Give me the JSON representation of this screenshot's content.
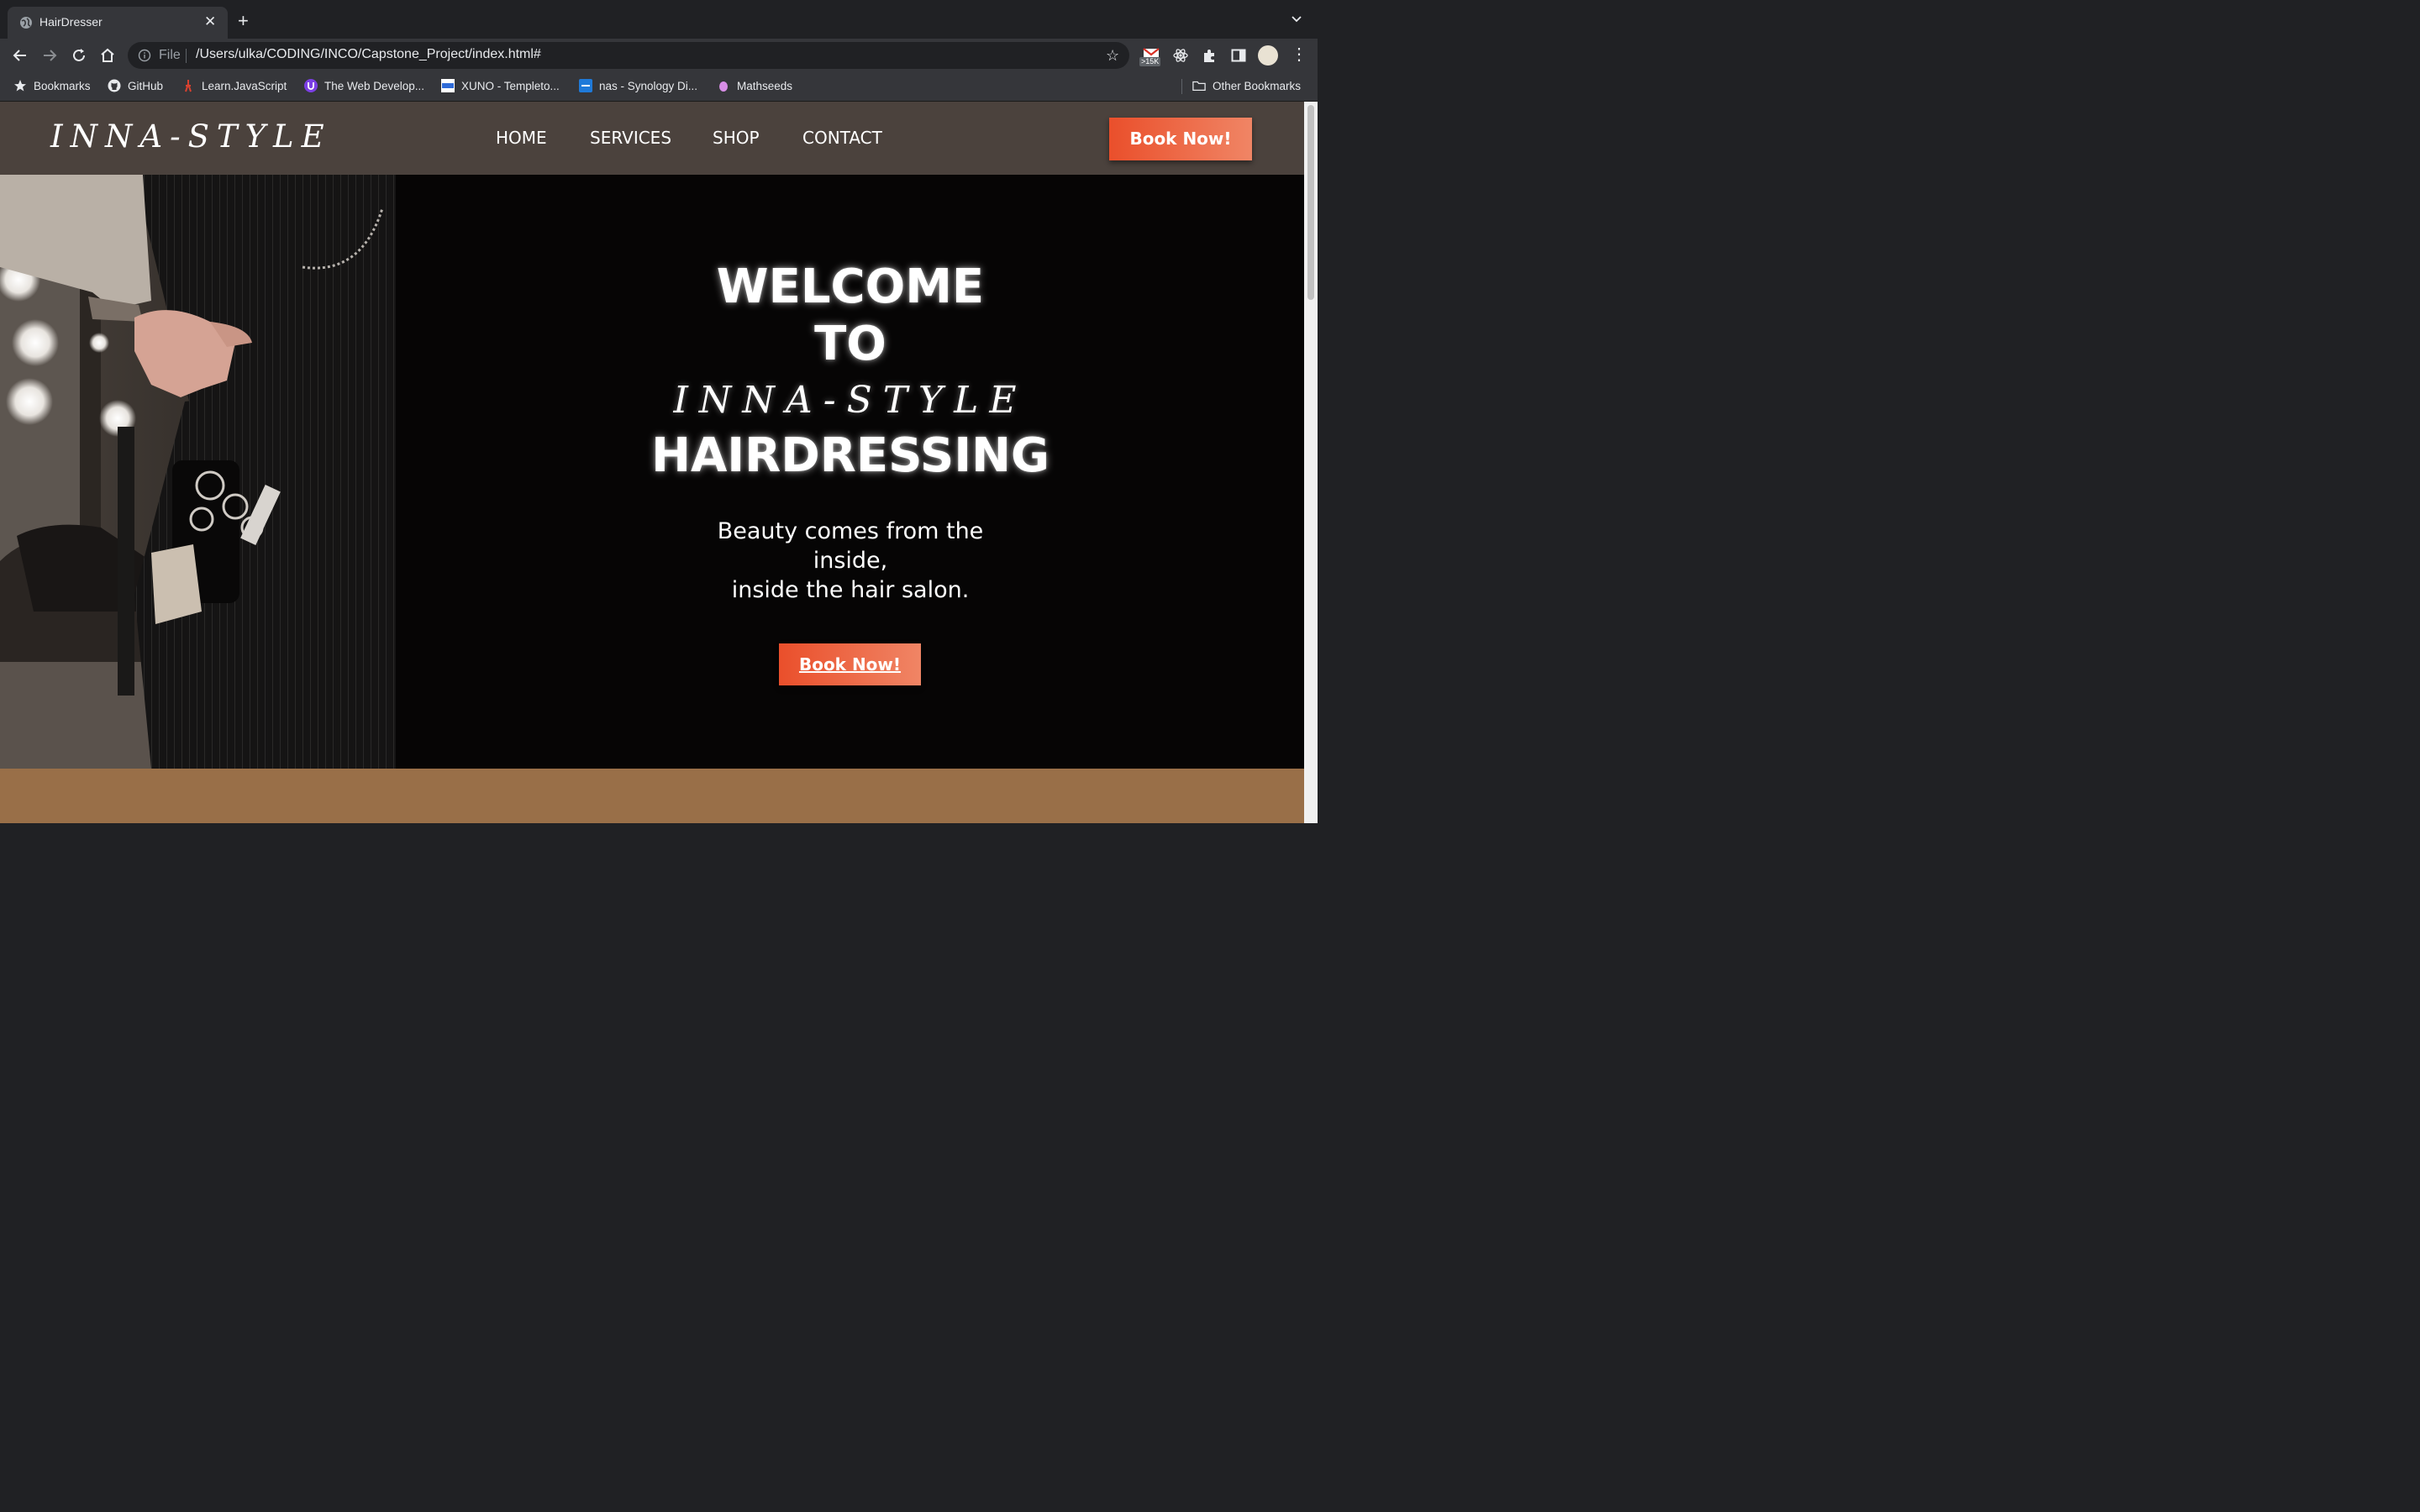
{
  "browser": {
    "tab": {
      "title": "HairDresser",
      "close": "✕"
    },
    "new_tab": "+",
    "omnibox": {
      "scheme": "File",
      "url": "/Users/ulka/CODING/INCO/Capstone_Project/index.html#"
    },
    "extensions": {
      "gmail_badge": ">15K"
    },
    "bookmarks": [
      {
        "label": "Bookmarks",
        "icon": "star-icon"
      },
      {
        "label": "GitHub",
        "icon": "github-icon"
      },
      {
        "label": "Learn.JavaScript",
        "icon": "javascript-icon"
      },
      {
        "label": "The Web Develop...",
        "icon": "web-dev-icon"
      },
      {
        "label": "XUNO - Templeto...",
        "icon": "xuno-icon"
      },
      {
        "label": "nas - Synology Di...",
        "icon": "synology-icon"
      },
      {
        "label": "Mathseeds",
        "icon": "mathseeds-icon"
      }
    ],
    "other_bookmarks": "Other Bookmarks"
  },
  "site": {
    "logo": "INNA-STYLE",
    "nav": [
      "HOME",
      "SERVICES",
      "SHOP",
      "CONTACT"
    ],
    "header_cta": "Book Now!",
    "hero": {
      "line1": "WELCOME",
      "line2": "TO",
      "line3": "INNA-STYLE",
      "line4": "HAIRDRESSING",
      "tagline1": "Beauty comes from the",
      "tagline2": "inside,",
      "tagline3": "inside the hair salon.",
      "cta": "Book Now!"
    }
  },
  "colors": {
    "nav_bg": "#4b423d",
    "accent": "#ea4f2b",
    "hero_bg": "#060505",
    "section_bg": "#996f48"
  }
}
